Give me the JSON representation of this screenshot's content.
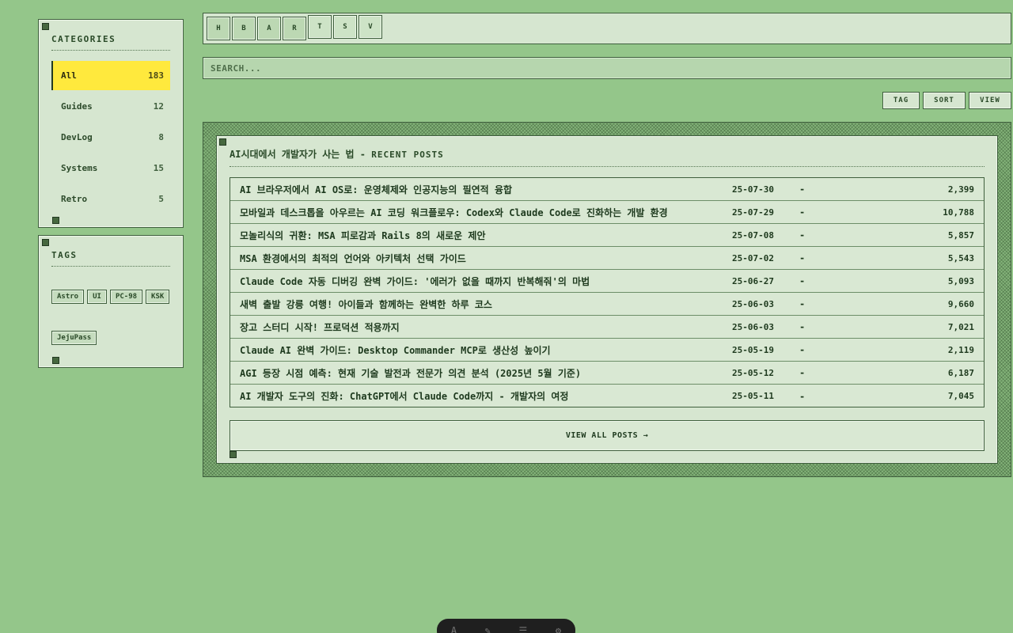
{
  "sidebar": {
    "categories_title": "CATEGORIES",
    "categories": [
      {
        "label": "All",
        "count": "183",
        "active": true
      },
      {
        "label": "Guides",
        "count": "12"
      },
      {
        "label": "DevLog",
        "count": "8"
      },
      {
        "label": "Systems",
        "count": "15"
      },
      {
        "label": "Retro",
        "count": "5"
      }
    ],
    "tags_title": "TAGS",
    "tags": [
      "Astro",
      "UI",
      "PC-98",
      "KSK",
      "JejuPass"
    ]
  },
  "toolbar": {
    "buttons": [
      "H",
      "B",
      "A",
      "R",
      "T",
      "S",
      "V"
    ]
  },
  "search": {
    "placeholder": "SEARCH..."
  },
  "actions": {
    "tag": "TAG",
    "sort": "SORT",
    "view": "VIEW"
  },
  "window": {
    "title_main": "AI시대에서 개발자가 사는 법",
    "title_sep": " - ",
    "title_sub": "RECENT POSTS"
  },
  "posts": [
    {
      "title": "AI 브라우저에서 AI OS로: 운영체제와 인공지능의 필연적 융합",
      "date": "25-07-30",
      "dash": "-",
      "views": "2,399"
    },
    {
      "title": "모바일과 데스크톱을 아우르는 AI 코딩 워크플로우: Codex와 Claude Code로 진화하는 개발 환경",
      "date": "25-07-29",
      "dash": "-",
      "views": "10,788"
    },
    {
      "title": "모놀리식의 귀환: MSA 피로감과 Rails 8의 새로운 제안",
      "date": "25-07-08",
      "dash": "-",
      "views": "5,857"
    },
    {
      "title": "MSA 환경에서의 최적의 언어와 아키텍처 선택 가이드",
      "date": "25-07-02",
      "dash": "-",
      "views": "5,543"
    },
    {
      "title": "Claude Code 자동 디버깅 완벽 가이드: '에러가 없을 때까지 반복해줘'의 마법",
      "date": "25-06-27",
      "dash": "-",
      "views": "5,093"
    },
    {
      "title": "새벽 출발 강릉 여행! 아이들과 함께하는 완벽한 하루 코스",
      "date": "25-06-03",
      "dash": "-",
      "views": "9,660"
    },
    {
      "title": "장고 스터디 시작! 프로덕션 적용까지",
      "date": "25-06-03",
      "dash": "-",
      "views": "7,021"
    },
    {
      "title": "Claude AI 완벽 가이드: Desktop Commander MCP로 생산성 높이기",
      "date": "25-05-19",
      "dash": "-",
      "views": "2,119"
    },
    {
      "title": "AGI 등장 시점 예측: 현재 기술 발전과 전문가 의견 분석 (2025년 5월 기준)",
      "date": "25-05-12",
      "dash": "-",
      "views": "6,187"
    },
    {
      "title": "AI 개발자 도구의 진화: ChatGPT에서 Claude Code까지 - 개발자의 여정",
      "date": "25-05-11",
      "dash": "-",
      "views": "7,045"
    }
  ],
  "view_all": "VIEW ALL POSTS →",
  "dock": {
    "icons": [
      "A",
      "✎",
      "☰",
      "⚙"
    ]
  }
}
